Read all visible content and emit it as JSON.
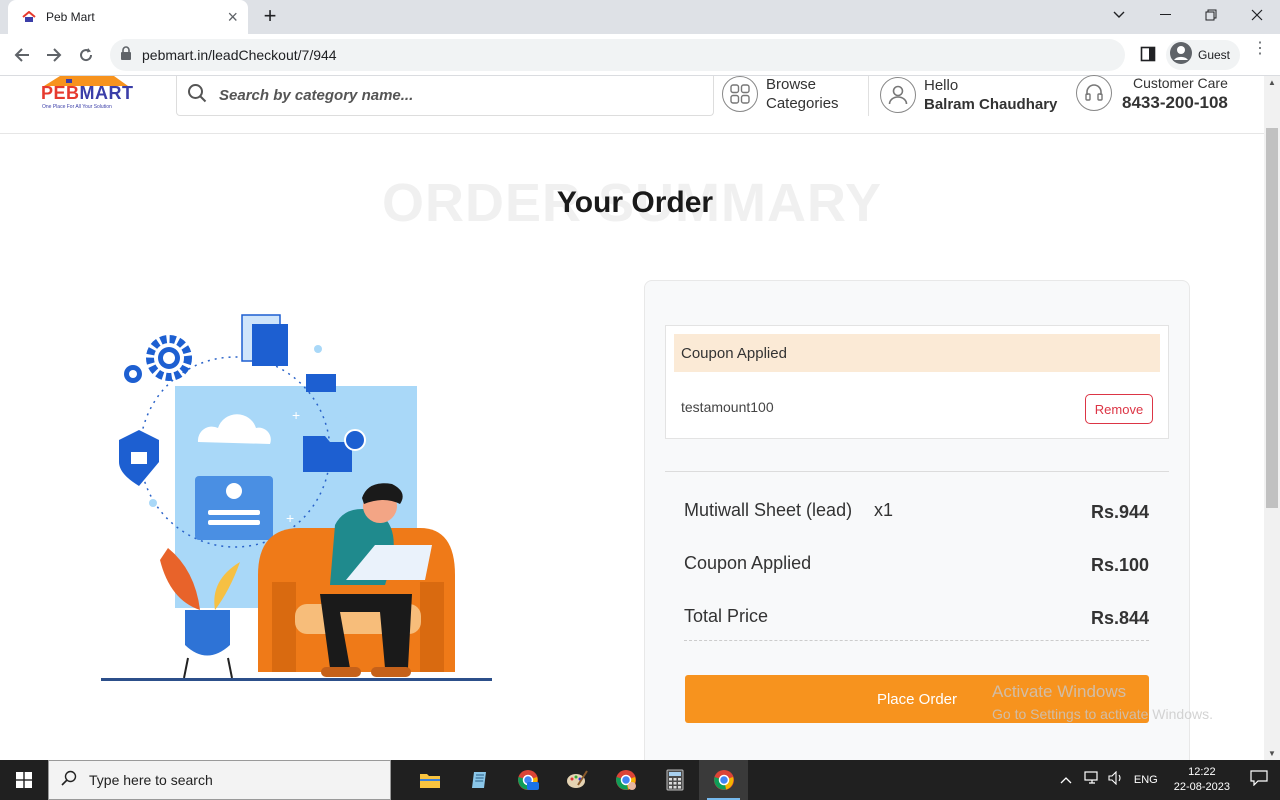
{
  "browser": {
    "tab_title": "Peb Mart",
    "url": "pebmart.in/leadCheckout/7/944",
    "profile_label": "Guest"
  },
  "header": {
    "logo_text_main": "PEB",
    "logo_text_accent": "MART",
    "logo_tagline": "One Place For All Your Solution",
    "search_placeholder": "Search by category name...",
    "browse_line1": "Browse",
    "browse_line2": "Categories",
    "hello_line1": "Hello",
    "hello_line2": "Balram Chaudhary",
    "care_label": "Customer Care",
    "care_phone": "8433-200-108"
  },
  "page": {
    "bg_title": "ORDER SUMMARY",
    "title": "Your Order"
  },
  "coupon": {
    "heading": "Coupon Applied",
    "code": "testamount100",
    "remove_label": "Remove"
  },
  "summary": {
    "item_name": "Mutiwall Sheet (lead)",
    "item_qty": "x1",
    "item_price": "Rs.944",
    "coupon_label": "Coupon Applied",
    "coupon_amount": "Rs.100",
    "total_label": "Total Price",
    "total_amount": "Rs.844"
  },
  "place_order_label": "Place Order",
  "watermark": {
    "line1": "Activate Windows",
    "line2": "Go to Settings to activate Windows."
  },
  "taskbar": {
    "search_placeholder": "Type here to search",
    "language": "ENG",
    "time": "12:22",
    "date": "22-08-2023"
  },
  "colors": {
    "accent_orange": "#f7931e",
    "coupon_bg": "#fbead6",
    "remove_red": "#dc3545",
    "brand_blue": "#3b3ea8"
  }
}
